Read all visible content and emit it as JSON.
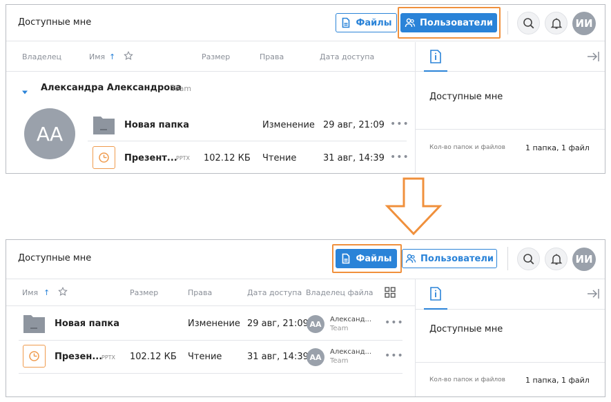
{
  "top": {
    "header": {
      "title": "Доступные мне",
      "files_btn": "Файлы",
      "users_btn": "Пользователи",
      "avatar_initials": "ИИ"
    },
    "columns": {
      "owner": "Владелец",
      "name": "Имя",
      "name_sort": "↑",
      "size": "Размер",
      "rights": "Права",
      "access_date": "Дата доступа"
    },
    "group": {
      "owner_name": "Александра Александрова",
      "owner_team": "Team",
      "avatar_initials": "АА"
    },
    "rows": [
      {
        "name": "Новая папка",
        "ext": "",
        "size": "",
        "rights": "Изменение",
        "date": "29 авг, 21:09",
        "more": "•••"
      },
      {
        "name": "Презент...",
        "ext": "PPTX",
        "size": "102.12 КБ",
        "rights": "Чтение",
        "date": "31 авг, 14:39",
        "more": "•••"
      }
    ],
    "sidebar": {
      "title": "Доступные мне",
      "count_label": "Кол-во папок и файлов",
      "count_value": "1 папка, 1 файл"
    }
  },
  "bottom": {
    "header": {
      "title": "Доступные мне",
      "files_btn": "Файлы",
      "users_btn": "Пользователи",
      "avatar_initials": "ИИ"
    },
    "columns": {
      "name": "Имя",
      "name_sort": "↑",
      "size": "Размер",
      "rights": "Права",
      "access_date": "Дата доступа",
      "file_owner": "Владелец файла"
    },
    "rows": [
      {
        "name": "Новая папка",
        "ext": "",
        "size": "",
        "rights": "Изменение",
        "date": "29 авг, 21:09",
        "owner": "Александ...",
        "team": "Team",
        "avatar": "АА",
        "more": "•••"
      },
      {
        "name": "Презен...",
        "ext": "PPTX",
        "size": "102.12 КБ",
        "rights": "Чтение",
        "date": "31 авг, 14:39",
        "owner": "Александ...",
        "team": "Team",
        "avatar": "АА",
        "more": "•••"
      }
    ],
    "sidebar": {
      "title": "Доступные мне",
      "count_label": "Кол-во папок и файлов",
      "count_value": "1 папка, 1 файл"
    }
  },
  "colors": {
    "accent": "#2a83d8",
    "highlight": "#f0903c",
    "avatar": "#9aa1ab",
    "folder": "#8e959f"
  }
}
